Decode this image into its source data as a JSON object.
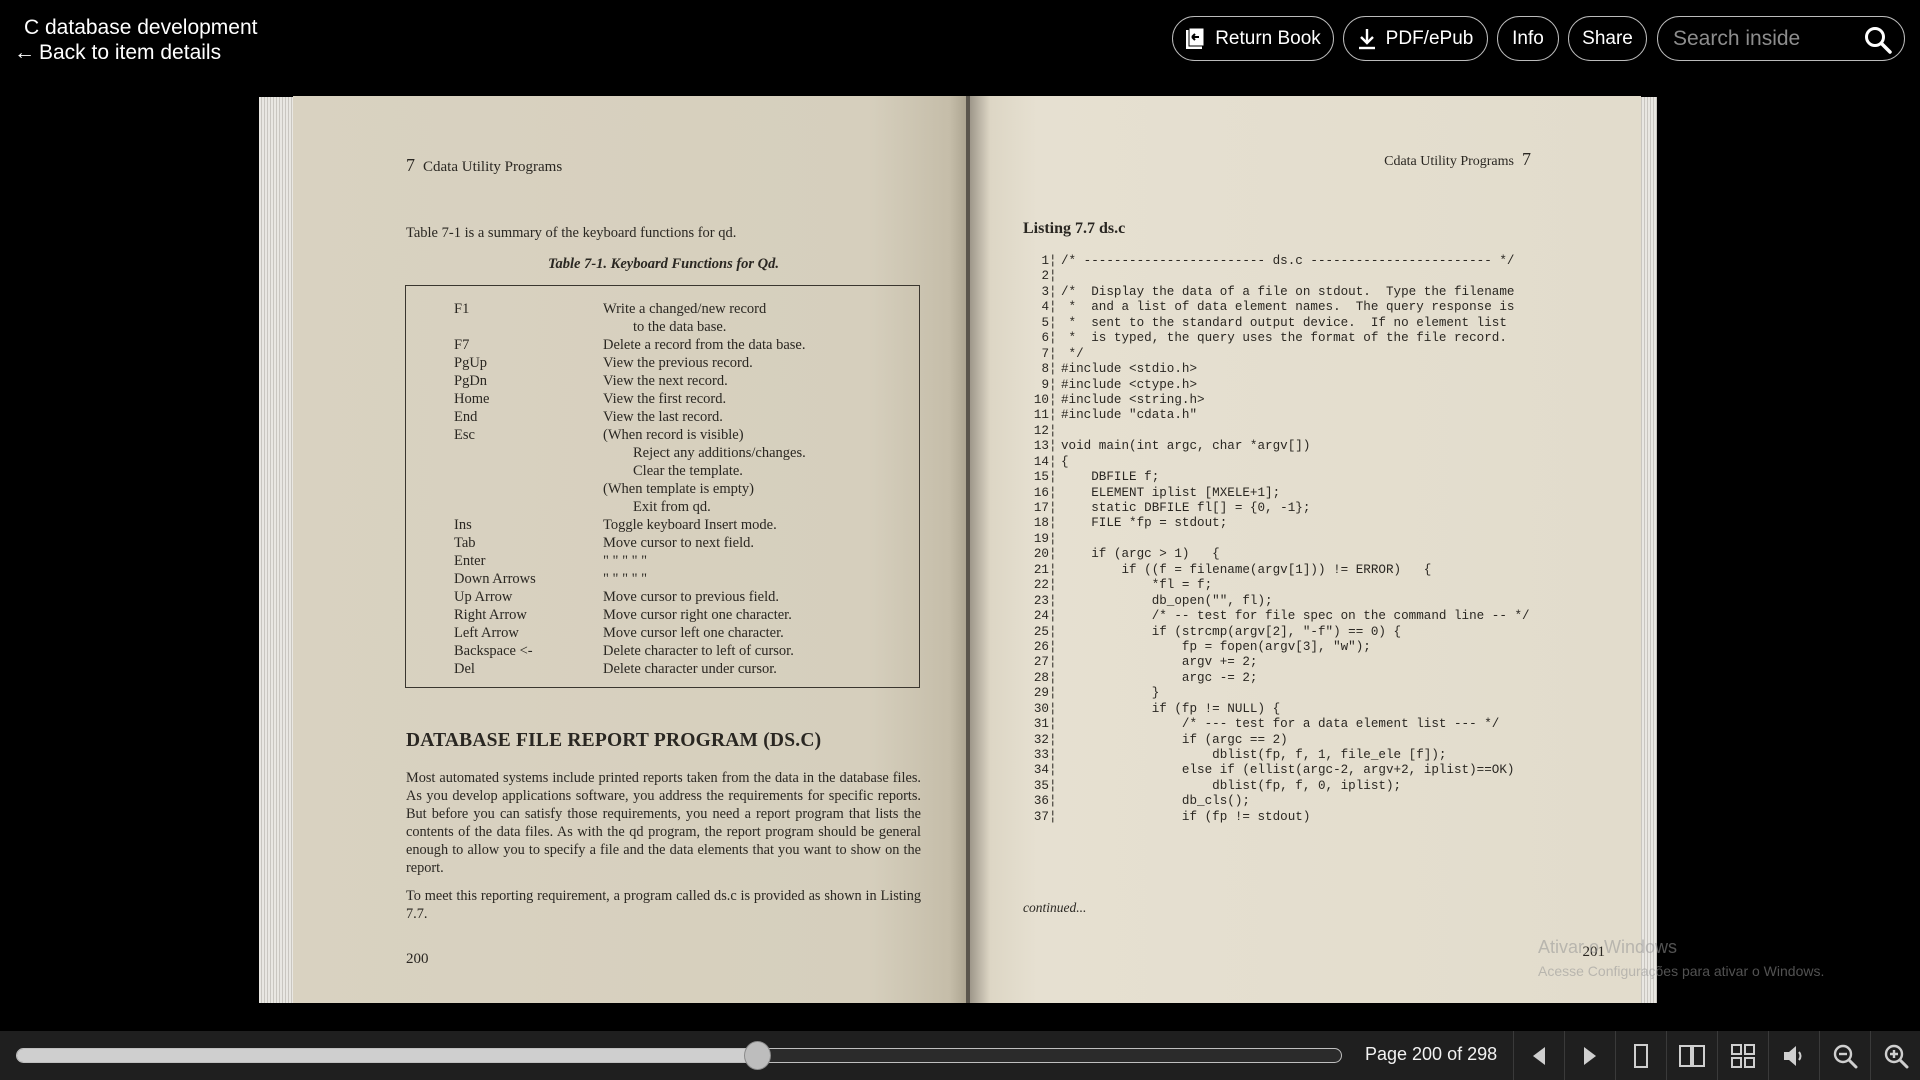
{
  "header": {
    "title": "C database development",
    "back_arrow": "←",
    "back_label": "Back to item details",
    "buttons": {
      "return_book": "Return Book",
      "pdf_epub": "PDF/ePub",
      "info": "Info",
      "share": "Share"
    },
    "search_placeholder": "Search inside"
  },
  "left_page": {
    "chapter_num": "7",
    "running_head": "Cdata Utility Programs",
    "intro": "Table 7-1 is a summary of the keyboard functions for qd.",
    "table_caption": "Table 7-1.  Keyboard Functions for Qd.",
    "table_rows": [
      {
        "key": "F1",
        "desc": "Write a changed/new record",
        "indent": false
      },
      {
        "key": "",
        "desc": "to the data base.",
        "indent": true
      },
      {
        "key": "F7",
        "desc": "Delete a record from the data base.",
        "indent": false
      },
      {
        "key": "PgUp",
        "desc": "View the previous record.",
        "indent": false
      },
      {
        "key": "PgDn",
        "desc": "View the next record.",
        "indent": false
      },
      {
        "key": "Home",
        "desc": "View the first record.",
        "indent": false
      },
      {
        "key": "End",
        "desc": "View the last record.",
        "indent": false
      },
      {
        "key": "Esc",
        "desc": "(When record is visible)",
        "indent": false
      },
      {
        "key": "",
        "desc": "Reject any additions/changes.",
        "indent": true
      },
      {
        "key": "",
        "desc": "Clear the template.",
        "indent": true
      },
      {
        "key": "",
        "desc": "(When template is empty)",
        "indent": false
      },
      {
        "key": "",
        "desc": "Exit from qd.",
        "indent": true
      },
      {
        "key": "Ins",
        "desc": "Toggle keyboard Insert mode.",
        "indent": false
      },
      {
        "key": "Tab",
        "desc": "Move cursor to next field.",
        "indent": false
      },
      {
        "key": "Enter",
        "desc": "\"    \"   \"    \"         \"",
        "indent": false
      },
      {
        "key": "Down Arrows",
        "desc": "\"    \"   \"    \"         \"",
        "indent": false
      },
      {
        "key": "Up Arrow",
        "desc": "Move cursor to previous field.",
        "indent": false
      },
      {
        "key": "Right Arrow",
        "desc": "Move cursor right one character.",
        "indent": false
      },
      {
        "key": "Left Arrow",
        "desc": "Move cursor left one character.",
        "indent": false
      },
      {
        "key": "Backspace <-",
        "desc": "Delete character to left of cursor.",
        "indent": false
      },
      {
        "key": "Del",
        "desc": "Delete character under cursor.",
        "indent": false
      }
    ],
    "section_heading": "DATABASE FILE REPORT PROGRAM (DS.C)",
    "paragraph_1": "Most automated systems include printed reports taken from the data in the database files. As you develop applications software, you address the requirements for specific reports. But before you can satisfy those requirements, you need a report program that lists the contents of the data files. As with the qd program, the report program should be general enough to allow you to specify a file and the data elements that you want to show on the report.",
    "paragraph_2": "To meet this reporting requirement, a program called ds.c is provided as shown in Listing 7.7.",
    "page_number": "200"
  },
  "right_page": {
    "running_head": "Cdata Utility Programs",
    "chapter_num": "7",
    "listing_title": "Listing 7.7 ds.c",
    "code_lines": [
      "/* ------------------------ ds.c ------------------------ */",
      "",
      "/*  Display the data of a file on stdout.  Type the filename",
      " *  and a list of data element names.  The query response is",
      " *  sent to the standard output device.  If no element list",
      " *  is typed, the query uses the format of the file record.",
      " */",
      "#include <stdio.h>",
      "#include <ctype.h>",
      "#include <string.h>",
      "#include \"cdata.h\"",
      "",
      "void main(int argc, char *argv[])",
      "{",
      "    DBFILE f;",
      "    ELEMENT iplist [MXELE+1];",
      "    static DBFILE fl[] = {0, -1};",
      "    FILE *fp = stdout;",
      "",
      "    if (argc > 1)   {",
      "        if ((f = filename(argv[1])) != ERROR)   {",
      "            *fl = f;",
      "            db_open(\"\", fl);",
      "            /* -- test for file spec on the command line -- */",
      "            if (strcmp(argv[2], \"-f\") == 0) {",
      "                fp = fopen(argv[3], \"w\");",
      "                argv += 2;",
      "                argc -= 2;",
      "            }",
      "            if (fp != NULL) {",
      "                /* --- test for a data element list --- */",
      "                if (argc == 2)",
      "                    dblist(fp, f, 1, file_ele [f]);",
      "                else if (ellist(argc-2, argv+2, iplist)==OK)",
      "                    dblist(fp, f, 0, iplist);",
      "                db_cls();",
      "                if (fp != stdout)"
    ],
    "continued": "continued...",
    "page_number": "201"
  },
  "watermark": {
    "line1": "Ativar o Windows",
    "line2": "Acesse Configurações para ativar o Windows."
  },
  "footer": {
    "page_indicator": "Page 200 of 298",
    "current_page": 200,
    "total_pages": 298,
    "progress_fraction": 0.559
  },
  "icons": {
    "return_book": "return-book-icon",
    "download": "download-icon",
    "search": "search-icon",
    "prev": "prev-page-icon",
    "next": "next-page-icon",
    "one_page": "one-page-view-icon",
    "two_page": "two-page-view-icon",
    "thumbnails": "thumbnail-view-icon",
    "read_aloud": "read-aloud-icon",
    "zoom_out": "zoom-out-icon",
    "zoom_in": "zoom-in-icon"
  }
}
